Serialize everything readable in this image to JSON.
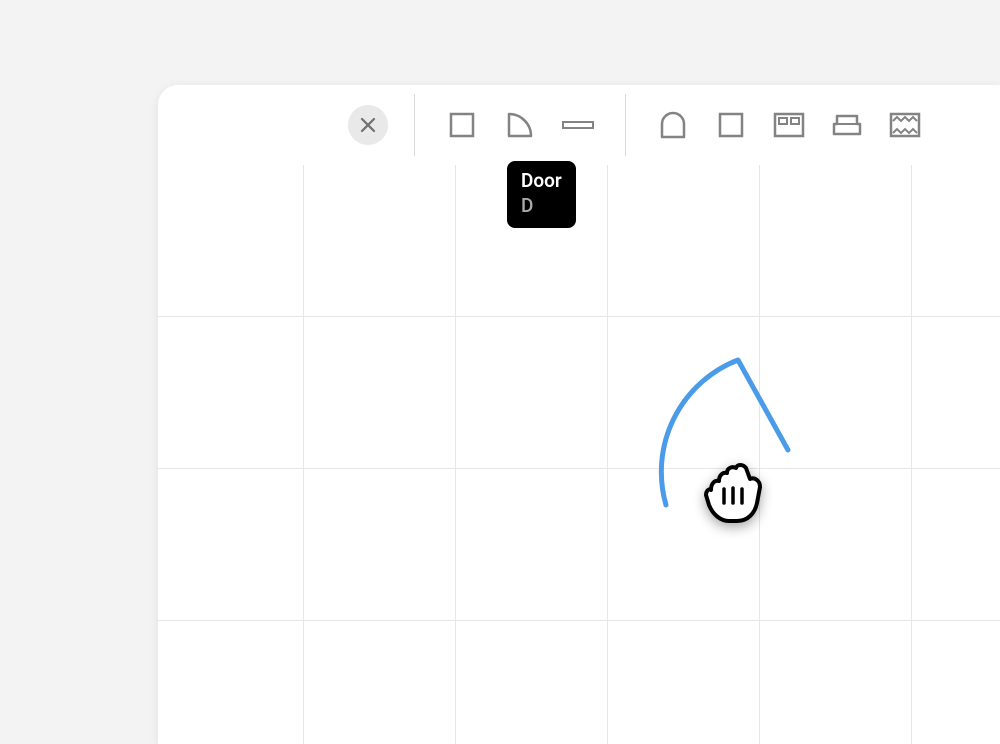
{
  "tooltip": {
    "title": "Door",
    "shortcut": "D"
  },
  "toolbar": {
    "close": "close",
    "square": "square",
    "door": "door",
    "window": "window",
    "arch": "arch",
    "room": "room",
    "cabinet": "cabinet",
    "sofa": "sofa",
    "zigzag": "zigzag"
  },
  "colors": {
    "stroke": "#838383",
    "accent": "#4a9be8"
  }
}
